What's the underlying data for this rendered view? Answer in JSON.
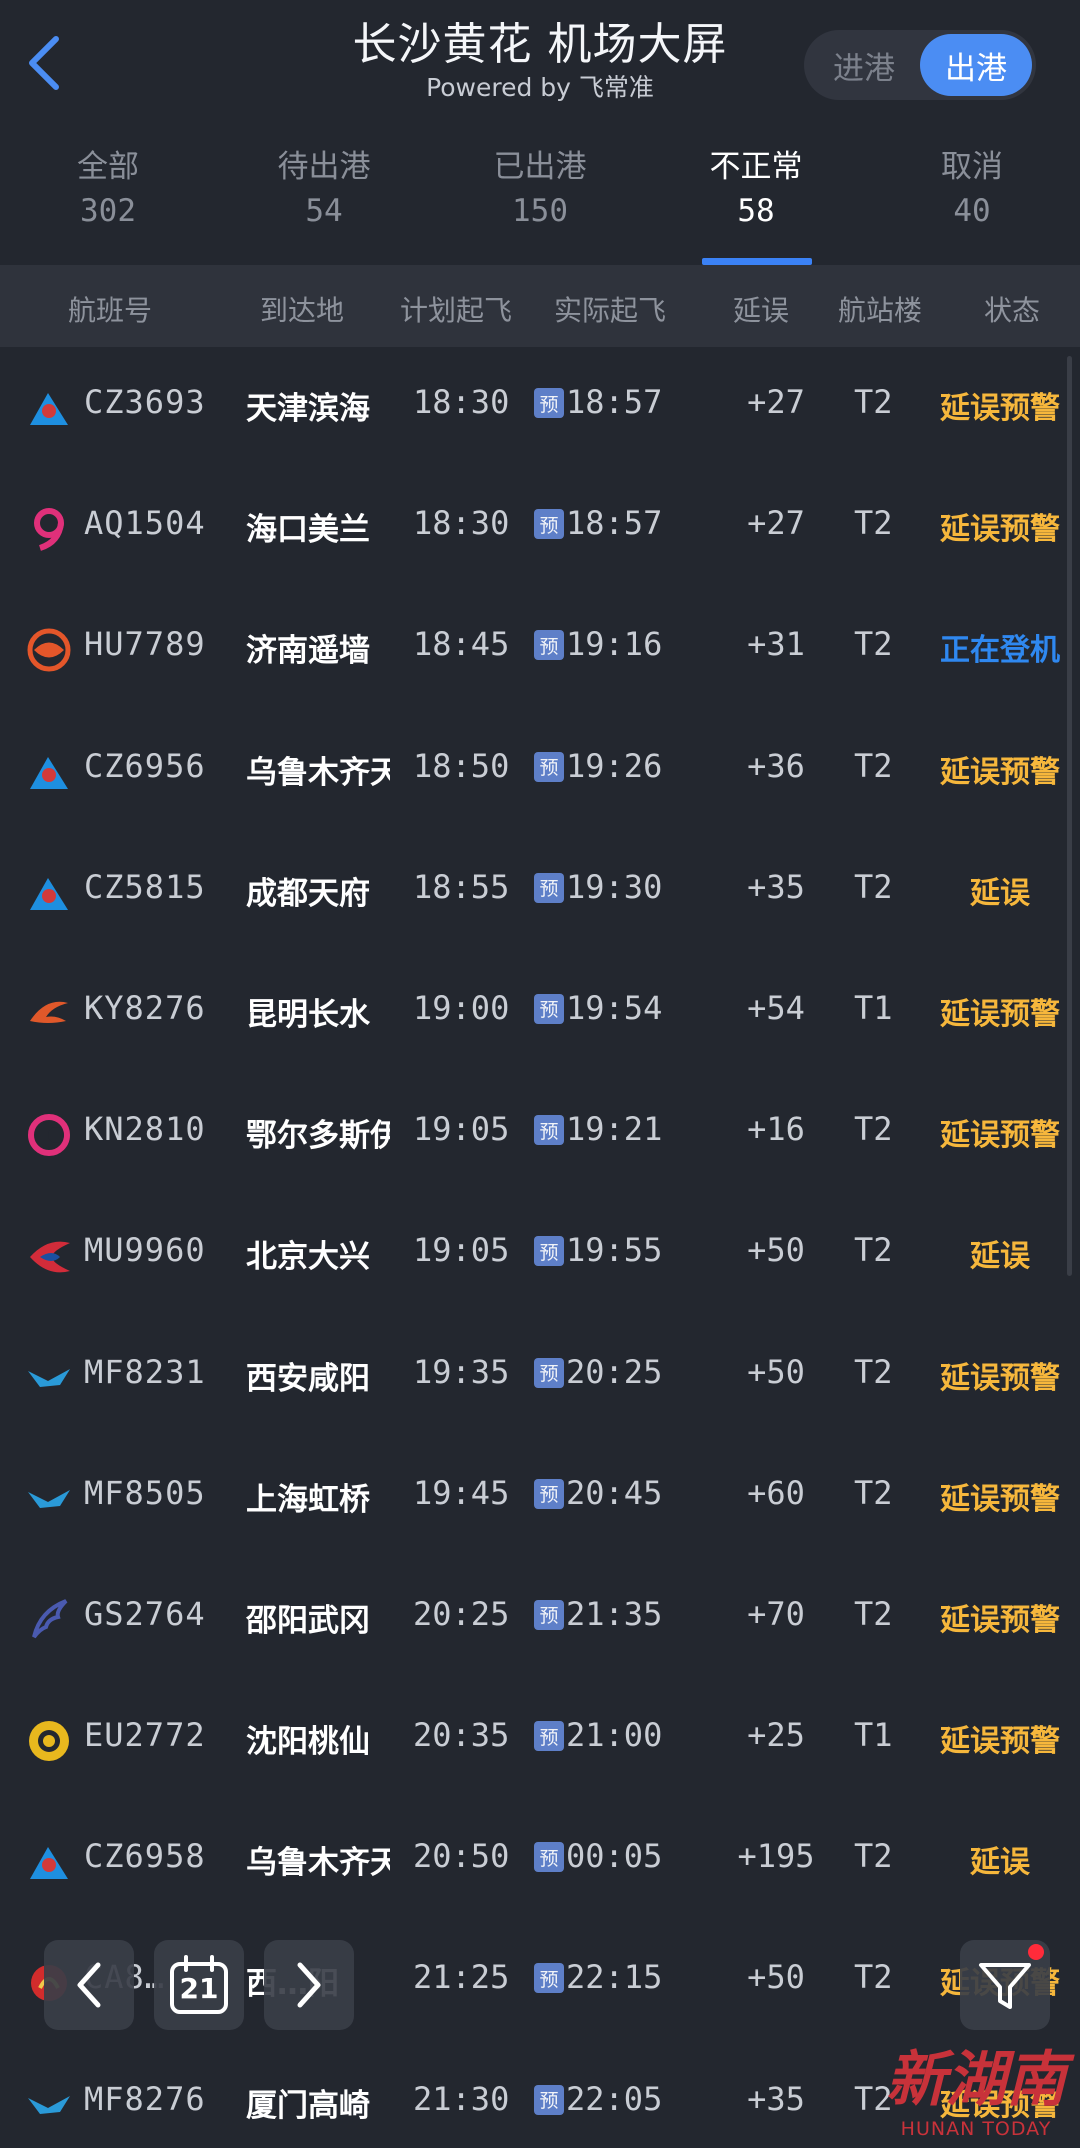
{
  "header": {
    "title": "长沙黄花 机场大屏",
    "subtitle": "Powered by 飞常准",
    "toggle": {
      "arrive": "进港",
      "depart": "出港",
      "active": "depart"
    }
  },
  "tabs": [
    {
      "label": "全部",
      "count": "302"
    },
    {
      "label": "待出港",
      "count": "54"
    },
    {
      "label": "已出港",
      "count": "150"
    },
    {
      "label": "不正常",
      "count": "58",
      "active": true
    },
    {
      "label": "取消",
      "count": "40"
    }
  ],
  "columns": {
    "flight": "航班号",
    "dest": "到达地",
    "scheduled": "计划起飞",
    "actual": "实际起飞",
    "delay": "延误",
    "terminal": "航站楼",
    "status": "状态"
  },
  "estimate_tag": "预",
  "colors": {
    "warning": "#f6b73c",
    "boarding": "#2f88f0",
    "accent": "#4b8df3"
  },
  "flights": [
    {
      "logo": "china-southern",
      "flight": "CZ3693",
      "dest": "天津滨海",
      "scheduled": "18:30",
      "actual": "18:57",
      "delay": "+27",
      "terminal": "T2",
      "status": "延误预警",
      "status_type": "warning"
    },
    {
      "logo": "hainan-9air",
      "flight": "AQ1504",
      "dest": "海口美兰",
      "scheduled": "18:30",
      "actual": "18:57",
      "delay": "+27",
      "terminal": "T2",
      "status": "延误预警",
      "status_type": "warning"
    },
    {
      "logo": "hainan-airlines",
      "flight": "HU7789",
      "dest": "济南遥墙",
      "scheduled": "18:45",
      "actual": "19:16",
      "delay": "+31",
      "terminal": "T2",
      "status": "正在登机",
      "status_type": "boarding"
    },
    {
      "logo": "china-southern",
      "flight": "CZ6956",
      "dest": "乌鲁木齐天",
      "scheduled": "18:50",
      "actual": "19:26",
      "delay": "+36",
      "terminal": "T2",
      "status": "延误预警",
      "status_type": "warning"
    },
    {
      "logo": "china-southern",
      "flight": "CZ5815",
      "dest": "成都天府",
      "scheduled": "18:55",
      "actual": "19:30",
      "delay": "+35",
      "terminal": "T2",
      "status": "延误",
      "status_type": "warning"
    },
    {
      "logo": "kunming-airlines",
      "flight": "KY8276",
      "dest": "昆明长水",
      "scheduled": "19:00",
      "actual": "19:54",
      "delay": "+54",
      "terminal": "T1",
      "status": "延误预警",
      "status_type": "warning"
    },
    {
      "logo": "china-united",
      "flight": "KN2810",
      "dest": "鄂尔多斯伊",
      "scheduled": "19:05",
      "actual": "19:21",
      "delay": "+16",
      "terminal": "T2",
      "status": "延误预警",
      "status_type": "warning"
    },
    {
      "logo": "china-eastern",
      "flight": "MU9960",
      "dest": "北京大兴",
      "scheduled": "19:05",
      "actual": "19:55",
      "delay": "+50",
      "terminal": "T2",
      "status": "延误",
      "status_type": "warning"
    },
    {
      "logo": "xiamen-air",
      "flight": "MF8231",
      "dest": "西安咸阳",
      "scheduled": "19:35",
      "actual": "20:25",
      "delay": "+50",
      "terminal": "T2",
      "status": "延误预警",
      "status_type": "warning"
    },
    {
      "logo": "xiamen-air",
      "flight": "MF8505",
      "dest": "上海虹桥",
      "scheduled": "19:45",
      "actual": "20:45",
      "delay": "+60",
      "terminal": "T2",
      "status": "延误预警",
      "status_type": "warning"
    },
    {
      "logo": "grand-china",
      "flight": "GS2764",
      "dest": "邵阳武冈",
      "scheduled": "20:25",
      "actual": "21:35",
      "delay": "+70",
      "terminal": "T2",
      "status": "延误预警",
      "status_type": "warning"
    },
    {
      "logo": "chengdu-airlines",
      "flight": "EU2772",
      "dest": "沈阳桃仙",
      "scheduled": "20:35",
      "actual": "21:00",
      "delay": "+25",
      "terminal": "T1",
      "status": "延误预警",
      "status_type": "warning"
    },
    {
      "logo": "china-southern",
      "flight": "CZ6958",
      "dest": "乌鲁木齐天",
      "scheduled": "20:50",
      "actual": "00:05",
      "delay": "+195",
      "terminal": "T2",
      "status": "延误",
      "status_type": "warning"
    },
    {
      "logo": "air-china",
      "flight": "CA8…",
      "dest": "西…阳",
      "scheduled": "21:25",
      "actual": "22:15",
      "delay": "+50",
      "terminal": "T2",
      "status": "延误预警",
      "status_type": "warning"
    },
    {
      "logo": "xiamen-air",
      "flight": "MF8276",
      "dest": "厦门高崎",
      "scheduled": "21:30",
      "actual": "22:05",
      "delay": "+35",
      "terminal": "T2",
      "status": "延误预警",
      "status_type": "warning"
    }
  ],
  "floating": {
    "date": "21",
    "prev_icon": "chevron-left-icon",
    "next_icon": "chevron-right-icon",
    "calendar_icon": "calendar-icon",
    "filter_icon": "filter-icon"
  },
  "watermark": {
    "main": "新湖南",
    "sub": "HUNAN TODAY"
  }
}
